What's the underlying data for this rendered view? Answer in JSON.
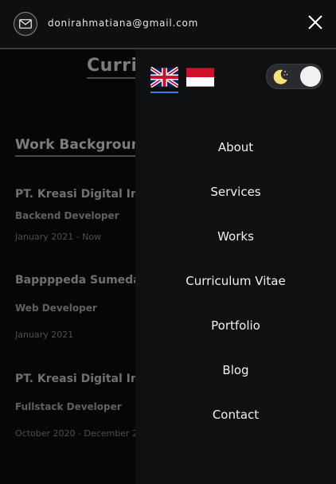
{
  "header": {
    "email": "donirahmatiana@gmail.com",
    "icons": {
      "mail": "mail-icon",
      "close": "close-icon"
    }
  },
  "page": {
    "title": "Curri",
    "section_title": "Work Background",
    "jobs": [
      {
        "company": "PT. Kreasi Digital Ind",
        "role": "Backend Developer",
        "date": "January 2021 - Now"
      },
      {
        "company": "Bappppeda Sumeda",
        "role": "Web Developer",
        "date": "January 2021"
      },
      {
        "company": "PT. Kreasi Digital Ind",
        "role": "Fullstack Developer",
        "date": "October 2020 - December 2"
      }
    ]
  },
  "menu": {
    "languages": [
      {
        "name": "uk-flag-icon",
        "active": true
      },
      {
        "name": "indonesia-flag-icon",
        "active": false
      }
    ],
    "theme_toggle": {
      "icon": "moon-icon",
      "dark_mode": true
    },
    "items": [
      {
        "label": "About"
      },
      {
        "label": "Services"
      },
      {
        "label": "Works"
      },
      {
        "label": "Curriculum Vitae"
      },
      {
        "label": "Portfolio"
      },
      {
        "label": "Blog"
      },
      {
        "label": "Contact"
      }
    ]
  },
  "colors": {
    "accent": "#3b82d6",
    "moon": "#f5e27a",
    "panel": "#0f1012"
  }
}
